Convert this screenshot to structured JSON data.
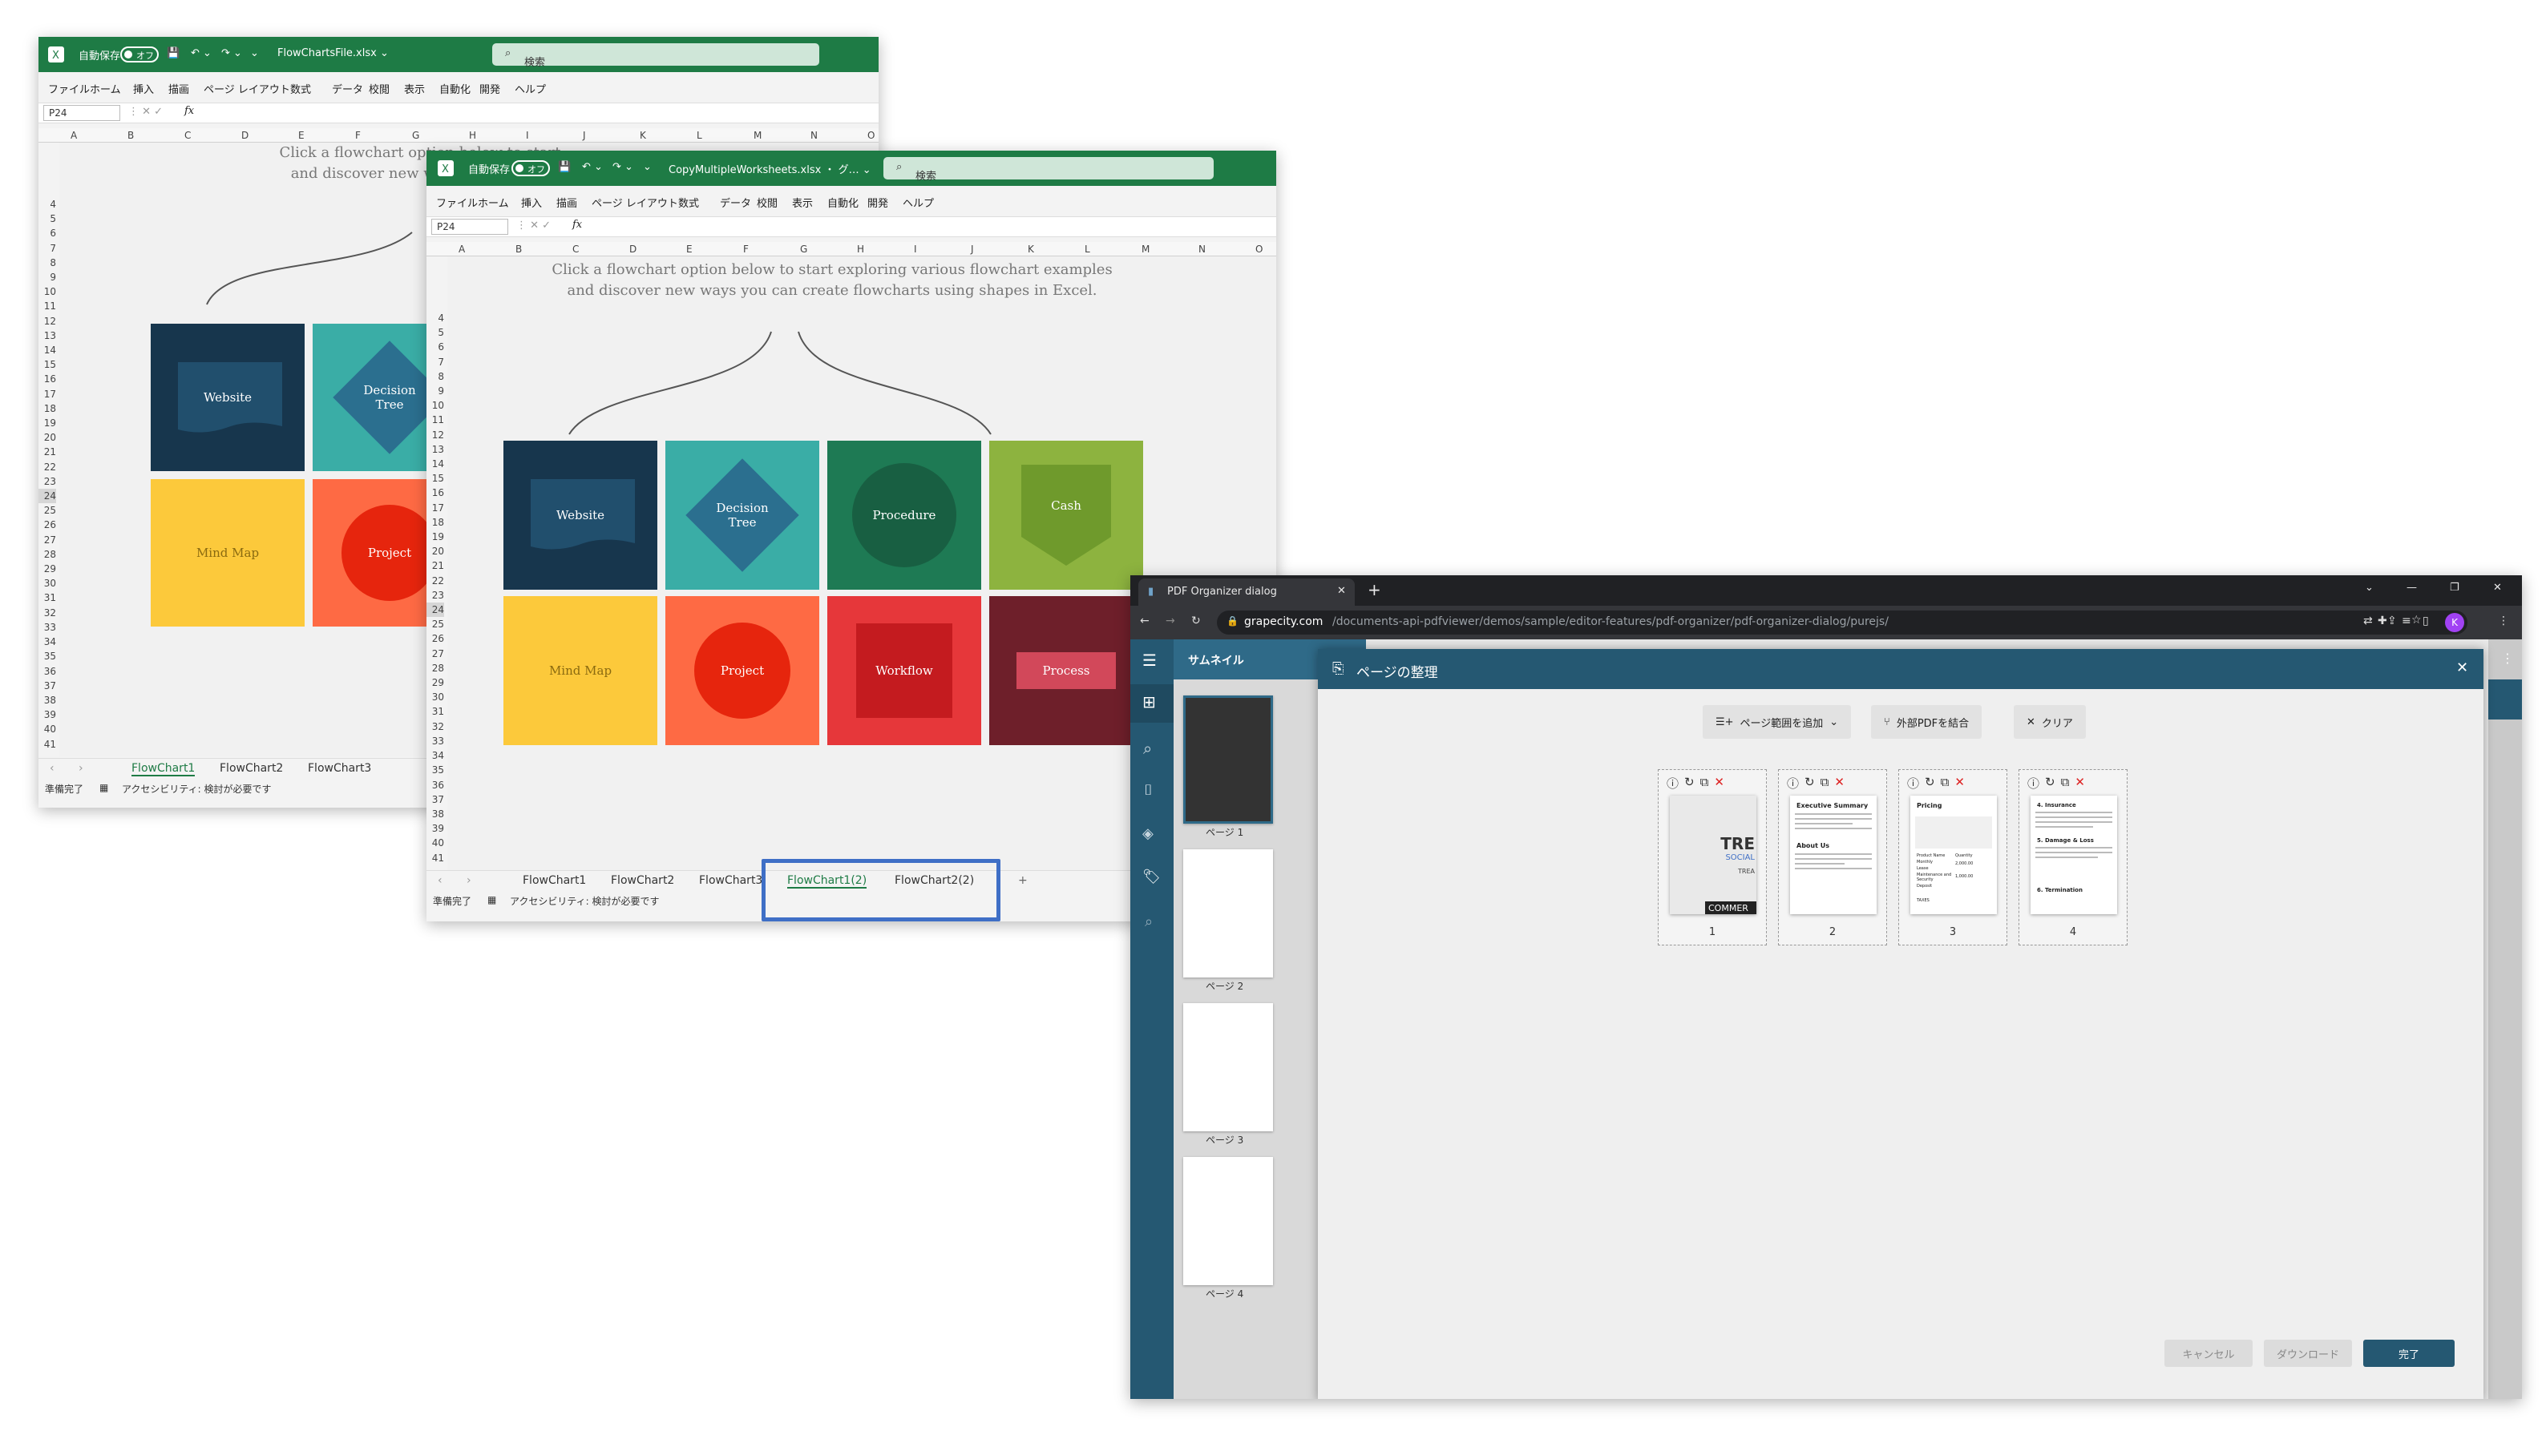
{
  "excel1": {
    "autosave_label": "自動保存",
    "toggle_label": "オフ",
    "file_name": "FlowChartsFile.xlsx ⌄",
    "search_placeholder": "検索",
    "menu": [
      "ファイル",
      "ホーム",
      "挿入",
      "描画",
      "ページ レイアウト",
      "数式",
      "データ",
      "校閲",
      "表示",
      "自動化",
      "開発",
      "ヘルプ"
    ],
    "name_box": "P24",
    "fx": "fx",
    "columns": [
      "A",
      "B",
      "C",
      "D",
      "E",
      "F",
      "G",
      "H",
      "I",
      "J",
      "K",
      "L",
      "M",
      "N",
      "O"
    ],
    "rows": [
      "4",
      "5",
      "6",
      "7",
      "8",
      "9",
      "10",
      "11",
      "12",
      "13",
      "14",
      "15",
      "16",
      "17",
      "18",
      "19",
      "20",
      "21",
      "22",
      "23",
      "24",
      "25",
      "26",
      "27",
      "28",
      "29",
      "30",
      "31",
      "32",
      "33",
      "34",
      "35",
      "36",
      "37",
      "38",
      "39",
      "40",
      "41"
    ],
    "note_line1": "Click a flowchart option below to start",
    "note_line2": "and discover new ways you can cre",
    "tiles": {
      "website": "Website",
      "decision": "Decision Tree",
      "mindmap": "Mind Map",
      "project": "Project"
    },
    "tabs": [
      "FlowChart1",
      "FlowChart2",
      "FlowChart3"
    ],
    "status_ready": "準備完了",
    "status_accessibility": "アクセシビリティ: 検討が必要です"
  },
  "excel2": {
    "autosave_label": "自動保存",
    "toggle_label": "オフ",
    "file_name": "CopyMultipleWorksheets.xlsx ・ グ… ⌄",
    "search_placeholder": "検索",
    "menu": [
      "ファイル",
      "ホーム",
      "挿入",
      "描画",
      "ページ レイアウト",
      "数式",
      "データ",
      "校閲",
      "表示",
      "自動化",
      "開発",
      "ヘルプ"
    ],
    "name_box": "P24",
    "fx": "fx",
    "columns": [
      "A",
      "B",
      "C",
      "D",
      "E",
      "F",
      "G",
      "H",
      "I",
      "J",
      "K",
      "L",
      "M",
      "N",
      "O"
    ],
    "rows": [
      "4",
      "5",
      "6",
      "7",
      "8",
      "9",
      "10",
      "11",
      "12",
      "13",
      "14",
      "15",
      "16",
      "17",
      "18",
      "19",
      "20",
      "21",
      "22",
      "23",
      "24",
      "25",
      "26",
      "27",
      "28",
      "29",
      "30",
      "31",
      "32",
      "33",
      "34",
      "35",
      "36",
      "37",
      "38",
      "39",
      "40",
      "41"
    ],
    "note_line1": "Click a flowchart option below to start exploring various flowchart examples",
    "note_line2": "and discover new ways you can create flowcharts using shapes in Excel.",
    "tiles": {
      "website": "Website",
      "decision": "Decision Tree",
      "procedure": "Procedure",
      "cash": "Cash",
      "mindmap": "Mind Map",
      "project": "Project",
      "workflow": "Workflow",
      "process": "Process"
    },
    "tabs": [
      "FlowChart1",
      "FlowChart2",
      "FlowChart3",
      "FlowChart1(2)",
      "FlowChart2(2)"
    ],
    "add_sheet": "+",
    "status_ready": "準備完了",
    "status_accessibility": "アクセシビリティ: 検討が必要です"
  },
  "browser": {
    "tab_title": "PDF Organizer dialog",
    "new_tab": "+",
    "url_domain": "grapecity.com",
    "url_path": "/documents-api-pdfviewer/demos/sample/editor-features/pdf-organizer/pdf-organizer-dialog/purejs/",
    "profile_initial": "K"
  },
  "viewer": {
    "thumbnails_title": "サムネイル",
    "page_labels": [
      "ページ 1",
      "ページ 2",
      "ページ 3",
      "ページ 4"
    ]
  },
  "dialog": {
    "title": "ページの整理",
    "add_range": "ページ範囲を追加",
    "merge_external": "外部PDFを結合",
    "clear": "クリア",
    "pages": [
      {
        "number": "1",
        "heading": "TRE",
        "sub1": "SOCIAL",
        "sub2": "TREA",
        "banner": "COMMER"
      },
      {
        "number": "2",
        "heading": "Executive Summary",
        "sub1": "About Us"
      },
      {
        "number": "3",
        "heading": "Pricing",
        "rows": [
          "Product Name",
          "Monthly",
          "Lease",
          "Maintenance and Security",
          "Deposit",
          "TAXES"
        ],
        "qty": "Quantity",
        "prices": [
          "2,000.00",
          "1,000.00"
        ]
      },
      {
        "number": "4",
        "heading": "4. Insurance",
        "sub1": "5. Damage & Loss",
        "sub2": "6. Termination"
      }
    ],
    "cancel": "キャンセル",
    "download": "ダウンロード",
    "done": "完了"
  },
  "colors": {
    "excel_green": "#1e7b45",
    "viewer_blue": "#255872",
    "highlight_blue": "#3f6fc6",
    "tile_navy": "#17364d",
    "tile_teal": "#3aada6",
    "tile_diamond": "#2b6f8f",
    "tile_green": "#1e7a54",
    "tile_olive": "#8db33f",
    "tile_yellow": "#fcc93b",
    "tile_orange": "#fe6a44",
    "tile_red": "#e6373a",
    "tile_maroon": "#6e1f2a"
  }
}
